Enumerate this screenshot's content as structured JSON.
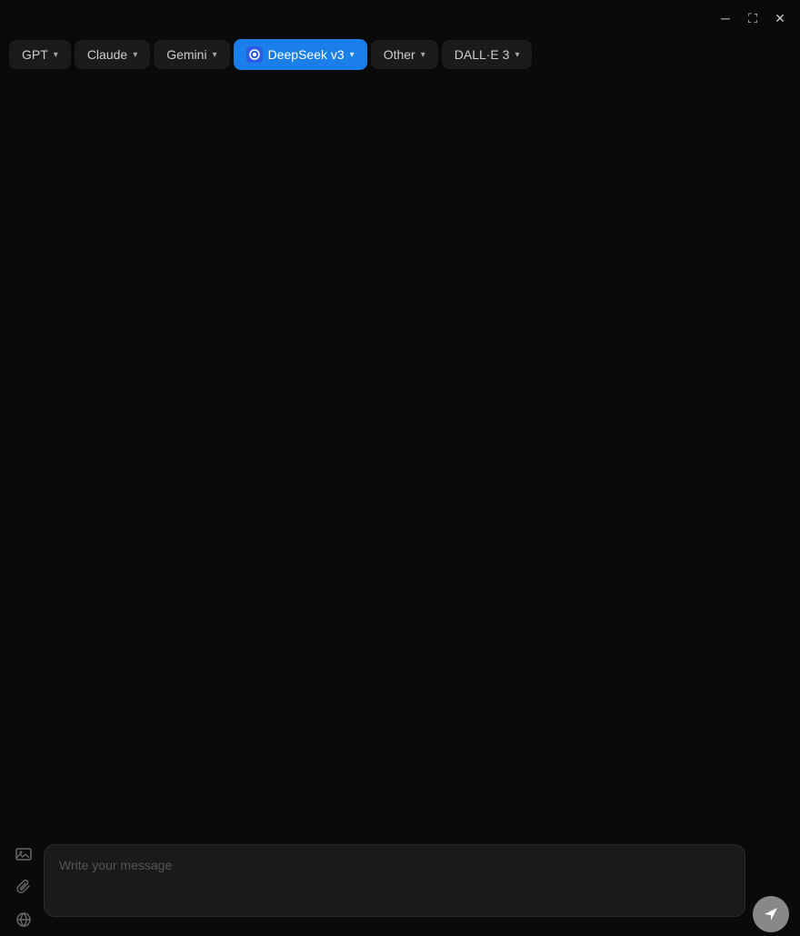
{
  "titleBar": {
    "minimizeLabel": "─",
    "maximizeLabel": "⛶",
    "closeLabel": "✕"
  },
  "tabs": [
    {
      "id": "gpt",
      "label": "GPT",
      "active": false,
      "hasIcon": false
    },
    {
      "id": "claude",
      "label": "Claude",
      "active": false,
      "hasIcon": false
    },
    {
      "id": "gemini",
      "label": "Gemini",
      "active": false,
      "hasIcon": false
    },
    {
      "id": "deepseek",
      "label": "DeepSeek v3",
      "active": true,
      "hasIcon": true
    },
    {
      "id": "other",
      "label": "Other",
      "active": false,
      "hasIcon": false
    },
    {
      "id": "dalle3",
      "label": "DALL·E 3",
      "active": false,
      "hasIcon": false
    }
  ],
  "input": {
    "placeholder": "Write your message",
    "value": ""
  },
  "icons": {
    "image": "🖼",
    "attach": "📎",
    "globe": "🌐",
    "send": "➤"
  }
}
